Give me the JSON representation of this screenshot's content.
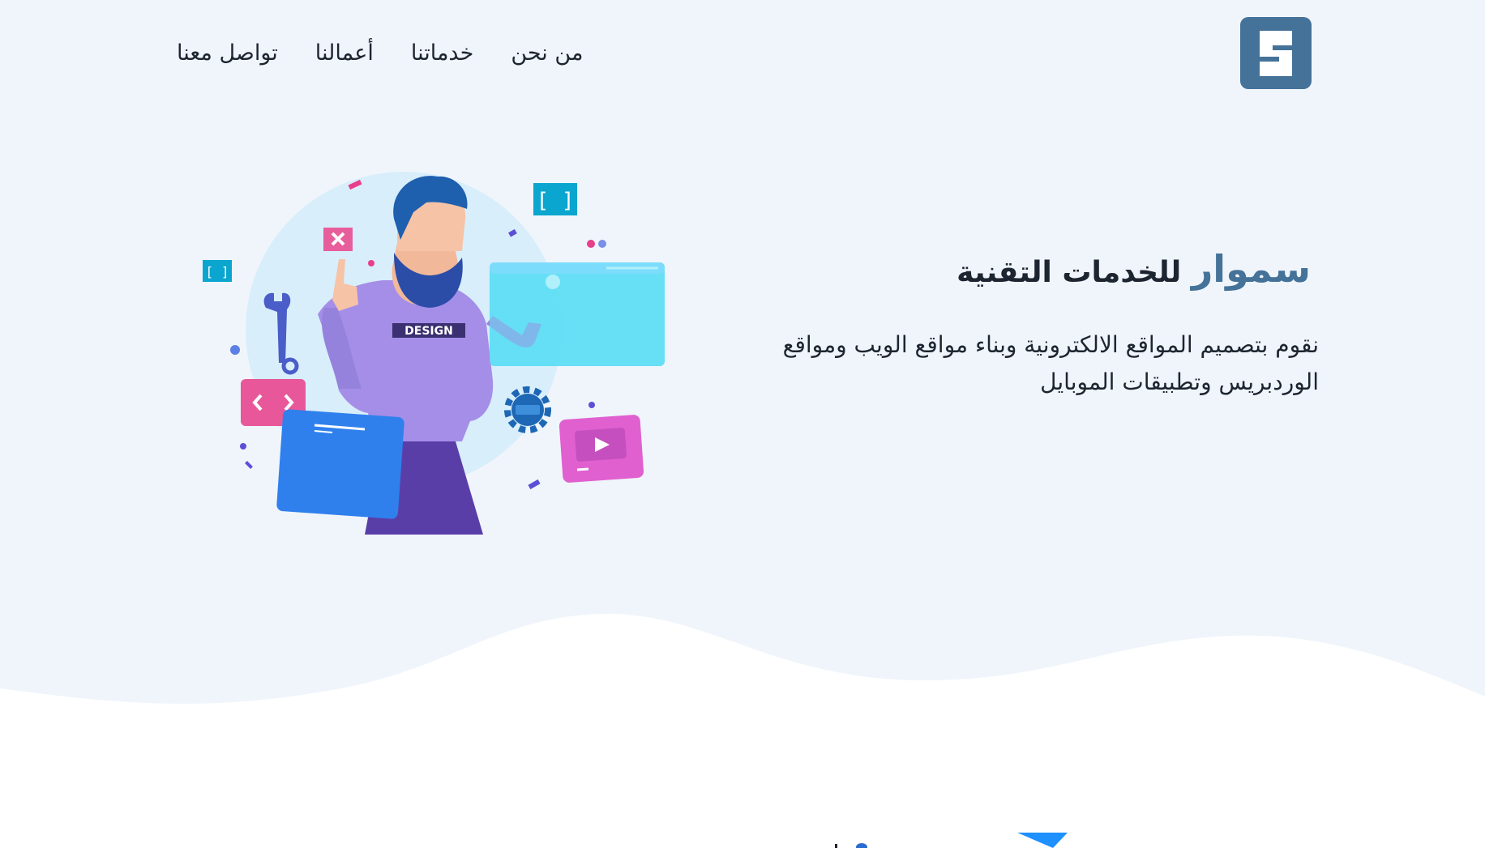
{
  "header": {
    "logo_letter": "S",
    "nav": [
      {
        "label": "من نحن"
      },
      {
        "label": "خدماتنا"
      },
      {
        "label": "أعمالنا"
      },
      {
        "label": "تواصل معنا"
      }
    ]
  },
  "hero": {
    "brand": "سموار",
    "title_rest": "للخدمات التقنية",
    "description": "نقوم بتصميم المواقع الالكترونية وبناء مواقع الويب ومواقع الوردبريس وتطبيقات الموبايل",
    "illustration_badge": "DESIGN"
  },
  "colors": {
    "brand": "#457299",
    "hero_background": "#f0f5fb",
    "text": "#1d2530"
  },
  "icons": [
    "logo-s-icon",
    "close-x-icon",
    "code-brackets-icon",
    "wrench-icon",
    "gear-icon",
    "play-icon",
    "paper-plane-icon"
  ]
}
